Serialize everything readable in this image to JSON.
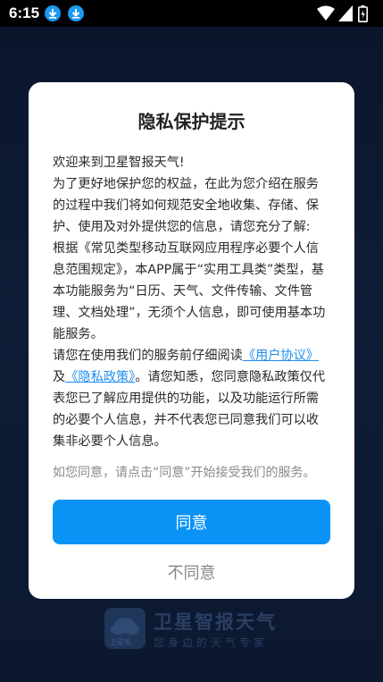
{
  "status_bar": {
    "time": "6:15"
  },
  "dialog": {
    "title": "隐私保护提示",
    "paragraphs": {
      "p1": "欢迎来到卫星智报天气!",
      "p2": "为了更好地保护您的权益，在此为您介绍在服务的过程中我们将如何规范安全地收集、存储、保护、使用及对外提供您的信息，请您充分了解:",
      "p3": "根据《常见类型移动互联网应用程序必要个人信息范围规定》，本APP属于“实用工具类”类型，基本功能服务为“日历、天气、文件传输、文件管理、文档处理”，无须个人信息，即可使用基本功能服务。",
      "p4_before": "请您在使用我们的服务前仔细阅读",
      "link_user_agreement": "《用户协议》",
      "and": "及",
      "link_privacy_policy": "《隐私政策》",
      "p4_after": "。请您知悉，您同意隐私政策仅代表您已了解应用提供的功能，以及功能运行所需的必要个人信息，并不代表您已同意我们可以收集非必要个人信息。"
    },
    "agree_hint": "如您同意，请点击“同意”开始接受我们的服务。",
    "agree_label": "同意",
    "disagree_label": "不同意"
  },
  "brand": {
    "logo_text": "卫星报",
    "name": "卫星智报天气",
    "slogan": "您身边的天气专家"
  },
  "colors": {
    "primary": "#0a93f5",
    "link": "#1f8ef1",
    "background": "#14274a"
  }
}
